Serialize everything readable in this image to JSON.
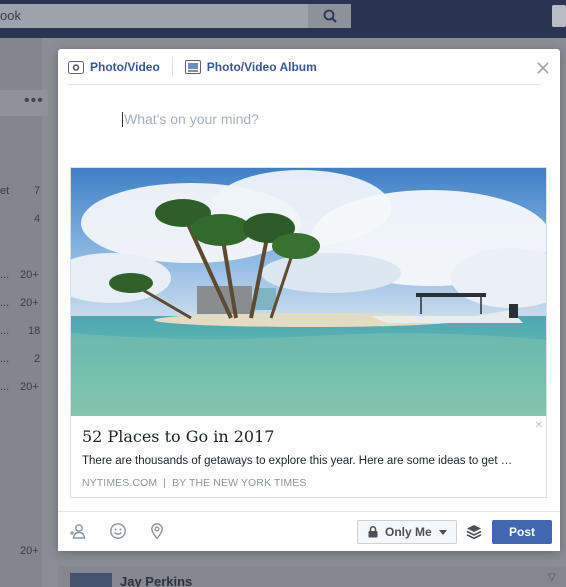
{
  "background": {
    "search_text": "ook",
    "left_fragment": "et",
    "counts": [
      "7",
      "4",
      "20+",
      "20+",
      "18",
      "2",
      "20+",
      "20+"
    ],
    "row_dots": [
      "...",
      "...",
      "...",
      "...",
      "..."
    ],
    "feed_name": "Jay Perkins"
  },
  "modal": {
    "tabs": [
      {
        "label": "Photo/Video",
        "icon": "camera-icon"
      },
      {
        "label": "Photo/Video Album",
        "icon": "album-icon"
      }
    ],
    "composer_placeholder": "What's on your mind?",
    "link_card": {
      "title": "52 Places to Go in 2017",
      "description": "There are thousands of getaways to explore this year. Here are some ideas to get …",
      "source": "NYTIMES.COM",
      "byline": "BY THE NEW YORK TIMES",
      "image": "tropical-island-photo"
    },
    "footer": {
      "icons": [
        "tag-friends-icon",
        "feeling-icon",
        "check-in-icon"
      ],
      "privacy_label": "Only Me",
      "post_label": "Post"
    }
  },
  "colors": {
    "accent": "#4267b2",
    "link": "#365899",
    "topbar": "#2a3553"
  }
}
